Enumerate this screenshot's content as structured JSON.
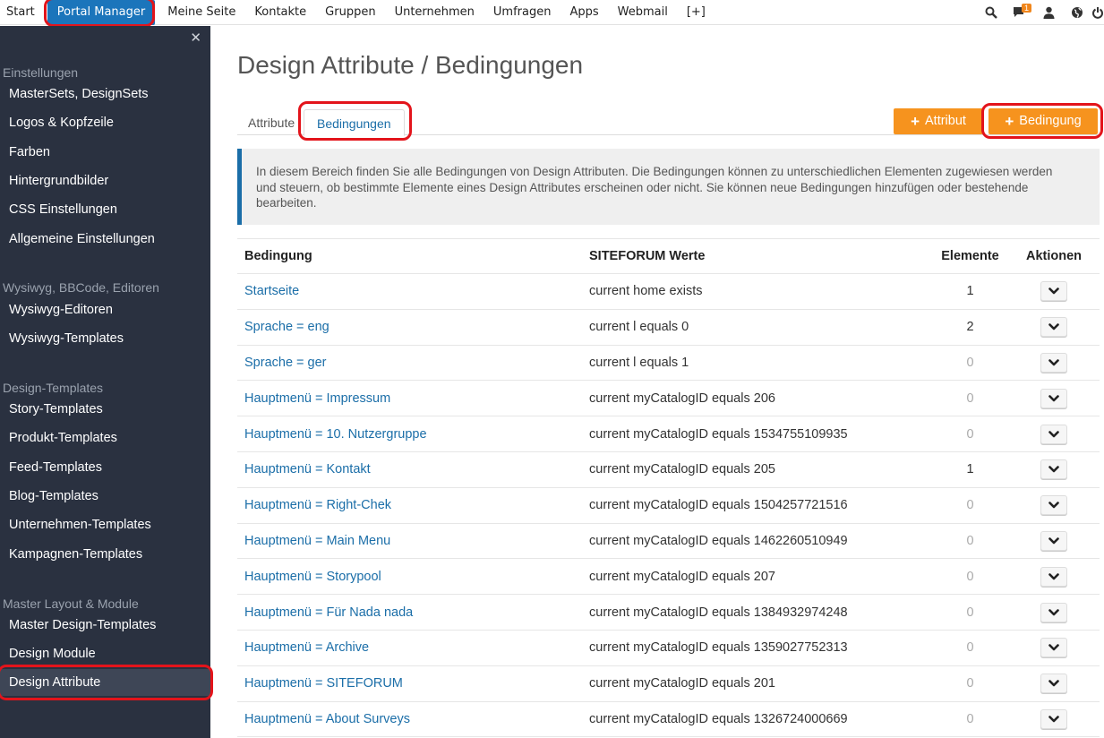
{
  "topnav": {
    "items": [
      "Start",
      "Portal Manager",
      "Meine Seite",
      "Kontakte",
      "Gruppen",
      "Unternehmen",
      "Umfragen",
      "Apps",
      "Webmail",
      "[+]"
    ],
    "active_index": 1,
    "notification_count": "1",
    "icons": [
      "search-icon",
      "chat-icon",
      "user-icon",
      "globe-icon",
      "power-icon"
    ]
  },
  "sidebar": {
    "close": "✕",
    "sections": [
      {
        "title": "Einstellungen",
        "items": [
          "MasterSets, DesignSets",
          "Logos & Kopfzeile",
          "Farben",
          "Hintergrundbilder",
          "CSS Einstellungen",
          "Allgemeine Einstellungen"
        ]
      },
      {
        "title": "Wysiwyg, BBCode, Editoren",
        "items": [
          "Wysiwyg-Editoren",
          "Wysiwyg-Templates"
        ]
      },
      {
        "title": "Design-Templates",
        "items": [
          "Story-Templates",
          "Produkt-Templates",
          "Feed-Templates",
          "Blog-Templates",
          "Unternehmen-Templates",
          "Kampagnen-Templates"
        ]
      },
      {
        "title": "Master Layout & Module",
        "items": [
          "Master Design-Templates",
          "Design Module",
          "Design Attribute"
        ]
      }
    ],
    "active_item": "Design Attribute"
  },
  "main": {
    "title": "Design Attribute / Bedingungen",
    "tabs": [
      "Attribute",
      "Bedingungen"
    ],
    "active_tab": "Bedingungen",
    "buttons": {
      "add_attribute": "Attribut",
      "add_condition": "Bedingung"
    },
    "info": "In diesem Bereich finden Sie alle Bedingungen von Design Attributen. Die Bedingungen können zu unterschiedlichen Elementen zugewiesen werden und steuern, ob bestimmte Elemente eines Design Attributes erscheinen oder nicht. Sie können neue Bedingungen hinzufügen oder bestehende bearbeiten.",
    "accent_color": "#f6931e",
    "link_color": "#1b6ea8"
  },
  "table": {
    "headers": [
      "Bedingung",
      "SITEFORUM Werte",
      "Elemente",
      "Aktionen"
    ],
    "rows": [
      {
        "name": "Startseite",
        "value": "current home exists",
        "count": "1"
      },
      {
        "name": "Sprache = eng",
        "value": "current l equals 0",
        "count": "2"
      },
      {
        "name": "Sprache = ger",
        "value": "current l equals 1",
        "count": "0"
      },
      {
        "name": "Hauptmenü = Impressum",
        "value": "current myCatalogID equals 206",
        "count": "0"
      },
      {
        "name": "Hauptmenü = 10. Nutzergruppe",
        "value": "current myCatalogID equals 1534755109935",
        "count": "0"
      },
      {
        "name": "Hauptmenü = Kontakt",
        "value": "current myCatalogID equals 205",
        "count": "1"
      },
      {
        "name": "Hauptmenü = Right-Chek",
        "value": "current myCatalogID equals 1504257721516",
        "count": "0"
      },
      {
        "name": "Hauptmenü = Main Menu",
        "value": "current myCatalogID equals 1462260510949",
        "count": "0"
      },
      {
        "name": "Hauptmenü = Storypool",
        "value": "current myCatalogID equals 207",
        "count": "0"
      },
      {
        "name": "Hauptmenü = Für Nada nada",
        "value": "current myCatalogID equals 1384932974248",
        "count": "0"
      },
      {
        "name": "Hauptmenü = Archive",
        "value": "current myCatalogID equals 1359027752313",
        "count": "0"
      },
      {
        "name": "Hauptmenü = SITEFORUM",
        "value": "current myCatalogID equals 201",
        "count": "0"
      },
      {
        "name": "Hauptmenü = About Surveys",
        "value": "current myCatalogID equals 1326724000669",
        "count": "0"
      }
    ]
  }
}
